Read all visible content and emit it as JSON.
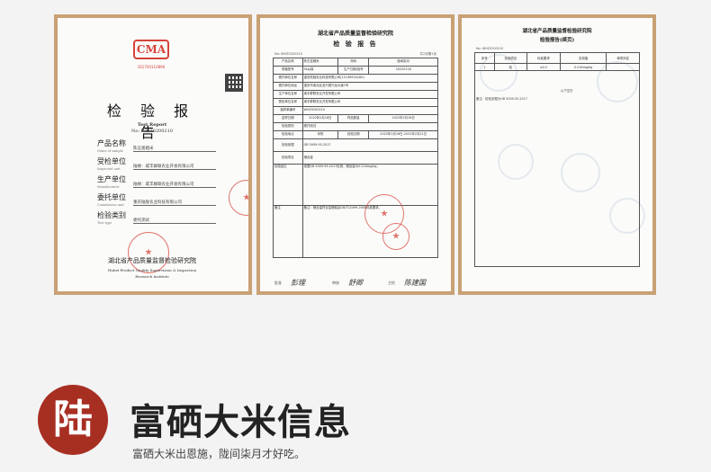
{
  "card1": {
    "cma_mark": "CMA",
    "cma_number": "161700110896",
    "title": "检 验 报 告",
    "subtitle": "Test  Report",
    "report_no": "No: WHZ0200210",
    "fields": [
      {
        "label": "产品名称",
        "en": "Name of sample",
        "value": "陈庄富硒米"
      },
      {
        "label": "受检单位",
        "en": "Inspected unit",
        "value": "陆缘：咸丰群联农业开发有限公司"
      },
      {
        "label": "生产单位",
        "en": "Manufacturer",
        "value": "陆缘：咸丰群联农业开发有限公司"
      },
      {
        "label": "委托单位",
        "en": "Commission unit",
        "value": "重庆陆陇农业科技有限公司"
      },
      {
        "label": "检验类别",
        "en": "Test type",
        "value": "委托测试"
      }
    ],
    "org": "湖北省产品质量监督检验研究院",
    "org_en_1": "Hubei Product Quality Supervision & Inspection",
    "org_en_2": "Research Institute"
  },
  "card2": {
    "org": "湖北省产品质量监督检验研究院",
    "title": "检 验 报 告",
    "report_no": "No: WHZ0200210",
    "page": "共2页第1页",
    "rows": [
      [
        "产品名称",
        "陈庄富硒米",
        "商标",
        "陇间柒月"
      ],
      [
        "规格型号",
        "5kg/袋",
        "生产日期/批号",
        "20220116"
      ],
      [
        "委托单位名称",
        "重庆陆陇农业科技有限公司(15136924180)",
        "",
        ""
      ],
      [
        "委托单位地址",
        "重庆市渝北区龙兴镇兴龙大道1号",
        "",
        ""
      ],
      [
        "生产单位名称",
        "咸丰群联农业开发有限公司",
        "",
        ""
      ],
      [
        "受检单位名称",
        "咸丰群联农业开发有限公司",
        "",
        ""
      ],
      [
        "抽样单编号",
        "WHZ0200210",
        "",
        ""
      ],
      [
        "送样日期",
        "2022年2月16日",
        "样品数量",
        "2022年2月16日"
      ],
      [
        "检验类别",
        "委托测试",
        "",
        ""
      ],
      [
        "检验地点",
        "本院",
        "检验日期",
        "2022年2月16日-2022年2月21日"
      ]
    ],
    "basis": "GB 5009.93-2017",
    "items": "硒含量",
    "conclusion": "依据GB 5009.93-2017检测，硒含量为0.216mg/kg。",
    "remark": "备注：硒含量符合富硒稻谷GB/T22499-2008标准要求。",
    "signers": [
      {
        "role": "批准",
        "name": "彭理"
      },
      {
        "role": "审核",
        "name": "舒卿"
      },
      {
        "role": "主检",
        "name": "陈建国"
      }
    ]
  },
  "card3": {
    "org": "湖北省产品质量监督检验研究院",
    "title": "检验报告(续页)",
    "report_no": "No: WHZ0200210",
    "headers": [
      "序号",
      "检验项目",
      "标准要求",
      "实测值",
      "单项判定"
    ],
    "row": [
      "1",
      "铅",
      "≤0.2",
      "0.216mg/kg",
      ""
    ],
    "remark": "备注：检验依据为GB 5009.93-2017",
    "end": "以下空白"
  },
  "footer": {
    "badge": "陆",
    "title": "富硒大米信息",
    "subtitle": "富硒大米出恩施，陇间柒月才好吃。"
  },
  "colors": {
    "frame": "#c9a175",
    "seal_red": "#d84a3e",
    "badge": "#a72f22",
    "background": "#f3f3f3"
  }
}
